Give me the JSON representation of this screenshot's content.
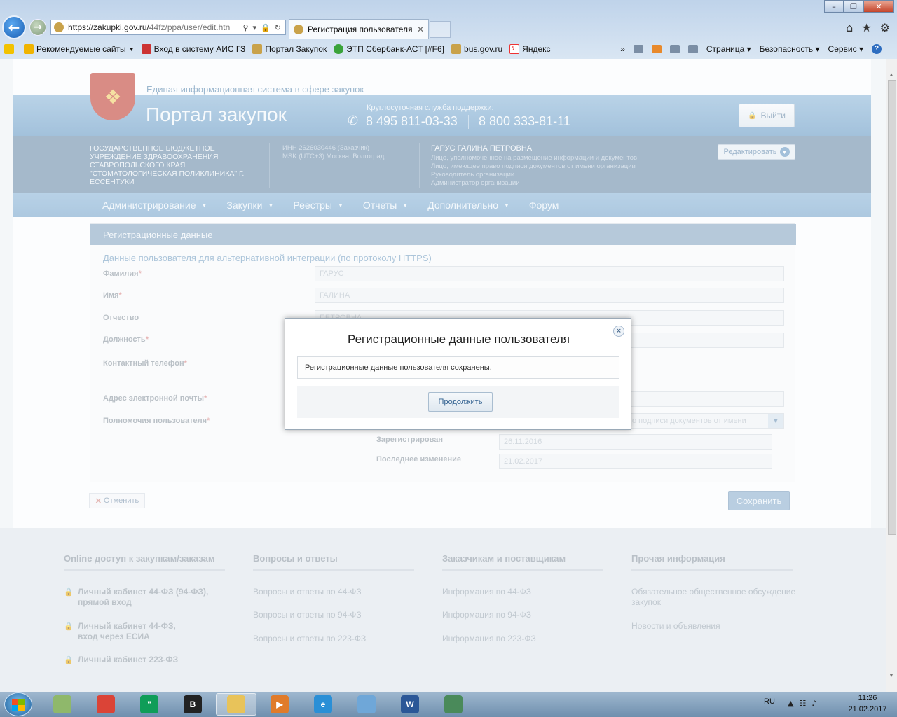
{
  "browser": {
    "url_main": "https://zakupki.gov.ru/",
    "url_dim": "44fz/ppa/user/edit.htn",
    "tab_title": "Регистрация пользователя",
    "favorites": [
      {
        "label": "Рекомендуемые сайты",
        "color": "#f0b400",
        "dropdown": true
      },
      {
        "label": "Вход в систему  АИС ГЗ",
        "color": "#c33",
        "dropdown": false
      },
      {
        "label": "Портал Закупок",
        "color": "#c9a24a",
        "dropdown": false
      },
      {
        "label": "ЭТП Сбербанк-АСТ [#F6]",
        "color": "#3aa33a",
        "dropdown": false
      },
      {
        "label": "bus.gov.ru",
        "color": "#c9a24a",
        "dropdown": false
      },
      {
        "label": "Яндекс",
        "color": "#e33",
        "dropdown": false
      }
    ],
    "tools": {
      "page": "Страница",
      "security": "Безопасность",
      "service": "Сервис"
    }
  },
  "site": {
    "subtitle": "Единая информационная система в сфере закупок",
    "title": "Портал закупок",
    "support_label": "Круглосуточная служба поддержки:",
    "phone_1": "8 495 811-03-33",
    "phone_2": "8 800 333-81-11",
    "logout": "Выйти",
    "org_name": "ГОСУДАРСТВЕННОЕ БЮДЖЕТНОЕ УЧРЕЖДЕНИЕ ЗДРАВООХРАНЕНИЯ СТАВРОПОЛЬСКОГО КРАЯ \"СТОМАТОЛОГИЧЕСКАЯ ПОЛИКЛИНИКА\" Г. ЕССЕНТУКИ",
    "org_inn": "ИНН 2626030446 (Заказчик)",
    "org_tz": "MSK (UTC+3) Москва, Волгоград",
    "user_name": "ГАРУС ГАЛИНА ПЕТРОВНА",
    "user_roles": [
      "Лицо, уполномоченное на размещение информации и документов",
      "Лицо, имеющее право подписи документов от имени организации",
      "Руководитель организации",
      "Администратор организации"
    ],
    "edit": "Редактировать",
    "nav": [
      {
        "label": "Администрирование",
        "dropdown": true
      },
      {
        "label": "Закупки",
        "dropdown": true
      },
      {
        "label": "Реестры",
        "dropdown": true
      },
      {
        "label": "Отчеты",
        "dropdown": true
      },
      {
        "label": "Дополнительно",
        "dropdown": true
      },
      {
        "label": "Форум",
        "dropdown": false
      }
    ]
  },
  "form": {
    "panel_title": "Регистрационные данные",
    "section_title": "Данные пользователя для альтернативной интеграции (по протоколу HTTPS)",
    "lastname_label": "Фамилия",
    "lastname_value": "ГАРУС",
    "firstname_label": "Имя",
    "firstname_value": "ГАЛИНА",
    "middlename_label": "Отчество",
    "middlename_value": "ПЕТРОВНА",
    "position_label": "Должность",
    "phone_label": "Контактный телефон",
    "email_label": "Адрес электронной почты",
    "permissions_label": "Полномочия пользователя",
    "permissions_value": "о подписи документов от имени",
    "registered_label": "Зарегистрирован",
    "registered_value": "26.11.2016",
    "modified_label": "Последнее изменение",
    "modified_value": "21.02.2017",
    "required_mark": "*",
    "cancel": "Отменить",
    "save": "Сохранить"
  },
  "footer": {
    "col1_title": "Online доступ к закупкам/заказам",
    "col1_links": [
      "Личный кабинет 44-ФЗ (94-ФЗ), прямой вход",
      "Личный кабинет 44-ФЗ, вход через ЕСИА",
      "Личный кабинет 223-ФЗ"
    ],
    "col2_title": "Вопросы и ответы",
    "col2_links": [
      "Вопросы и ответы по 44-ФЗ",
      "Вопросы и ответы по 94-ФЗ",
      "Вопросы и ответы по 223-ФЗ"
    ],
    "col3_title": "Заказчикам и поставщикам",
    "col3_links": [
      "Информация по 44-ФЗ",
      "Информация по 94-ФЗ",
      "Информация по 223-ФЗ"
    ],
    "col4_title": "Прочая информация",
    "col4_links": [
      "Обязательное общественное обсуждение закупок",
      "Новости и объявления"
    ]
  },
  "modal": {
    "title": "Регистрационные данные пользователя",
    "message": "Регистрационные данные пользователя сохранены.",
    "continue": "Продолжить",
    "close": "×"
  },
  "taskbar": {
    "apps": [
      {
        "name": "files-app",
        "color": "#8fb86b",
        "label": ""
      },
      {
        "name": "chrome-app",
        "color": "#db4437",
        "label": ""
      },
      {
        "name": "hangouts-app",
        "color": "#0f9d58",
        "label": "\""
      },
      {
        "name": "bat-app",
        "color": "#222",
        "label": "B"
      },
      {
        "name": "explorer-app",
        "color": "#e8c35a",
        "label": ""
      },
      {
        "name": "media-app",
        "color": "#e07b2a",
        "label": "▶"
      },
      {
        "name": "ie-app",
        "color": "#2a8fd6",
        "label": "e"
      },
      {
        "name": "tool-app",
        "color": "#6fa7d8",
        "label": ""
      },
      {
        "name": "word-app",
        "color": "#2b5797",
        "label": "W"
      },
      {
        "name": "image-app",
        "color": "#4a8a5a",
        "label": ""
      }
    ],
    "lang": "RU",
    "time": "11:26",
    "date": "21.02.2017"
  },
  "colors": {
    "accent": "#6a9cc6",
    "brand_red": "#c2463b"
  }
}
